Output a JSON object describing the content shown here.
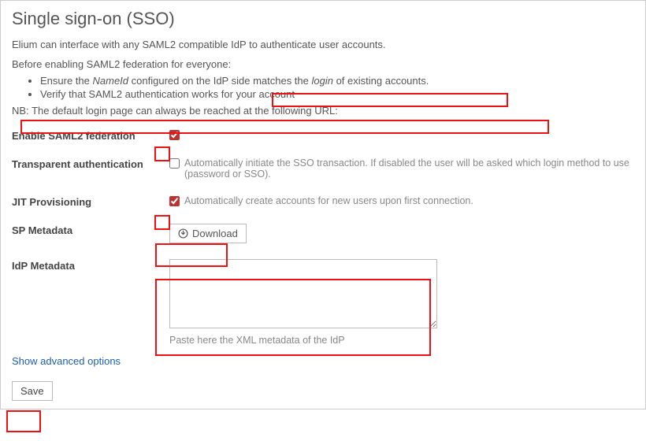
{
  "title": "Single sign-on (SSO)",
  "intro": "Elium can interface with any SAML2 compatible IdP to authenticate user accounts.",
  "before": "Before enabling SAML2 federation for everyone:",
  "bullets": {
    "b1_pre": "Ensure the ",
    "b1_em1": "NameId",
    "b1_mid": " configured on the IdP side matches the ",
    "b1_em2": "login",
    "b1_post": " of existing accounts.",
    "b2": "Verify that SAML2 authentication works for your account"
  },
  "nb_pre": "NB: ",
  "nb_rest": "The default login page can always be reached at the following URL:",
  "rows": {
    "enable": {
      "label": "Enable SAML2 federation"
    },
    "transparent": {
      "label": "Transparent authentication",
      "desc": "Automatically initiate the SSO transaction. If disabled the user will be asked which login method to use (password or SSO)."
    },
    "jit": {
      "label": "JIT Provisioning",
      "desc": "Automatically create accounts for new users upon first connection."
    },
    "sp": {
      "label": "SP Metadata",
      "button": "Download"
    },
    "idp": {
      "label": "IdP Metadata",
      "hint": "Paste here the XML metadata of the IdP"
    }
  },
  "advanced": "Show advanced options",
  "save": "Save"
}
